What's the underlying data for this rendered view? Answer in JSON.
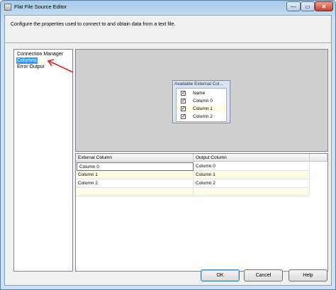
{
  "window": {
    "title": "Flat File Source Editor",
    "controls": {
      "minimize": "—",
      "maximize": "▭",
      "close": "✕"
    }
  },
  "description": "Configure the properties used to connect to and obtain data from a text file.",
  "nav": {
    "items": [
      {
        "label": "Connection Manager",
        "selected": false
      },
      {
        "label": "Columns",
        "selected": true
      },
      {
        "label": "Error Output",
        "selected": false
      }
    ]
  },
  "external_columns_box": {
    "title": "Available External Col...",
    "rows": [
      {
        "label": "Name",
        "checked": true
      },
      {
        "label": "Column 0",
        "checked": true
      },
      {
        "label": "Column 1",
        "checked": true
      },
      {
        "label": "Column 2",
        "checked": true
      }
    ]
  },
  "grid": {
    "headers": [
      "External Column",
      "Output Column"
    ],
    "rows": [
      [
        "Column 0",
        "Column 0"
      ],
      [
        "Column 1",
        "Column 1"
      ],
      [
        "Column 2",
        "Column 2"
      ]
    ]
  },
  "buttons": {
    "ok": "OK",
    "cancel": "Cancel",
    "help": "Help"
  },
  "colors": {
    "selection": "#3399ff",
    "annotation_arrow": "#e02020",
    "alt_row": "#fffde6"
  },
  "icons": {
    "check": "✓"
  }
}
